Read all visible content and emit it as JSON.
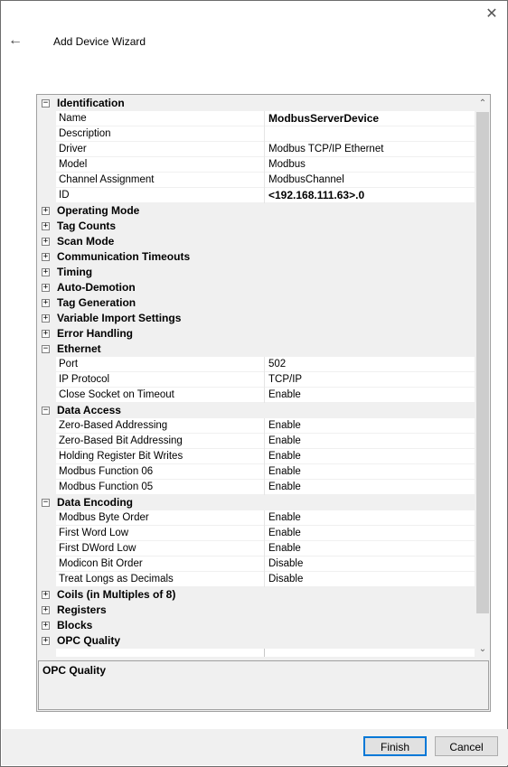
{
  "window": {
    "title": "Add Device Wizard",
    "close_glyph": "✕",
    "back_glyph": "←"
  },
  "grid": {
    "rows": [
      {
        "kind": "cat",
        "label": "Identification",
        "toggle": "−"
      },
      {
        "kind": "prop",
        "name": "Name",
        "value": "ModbusServerDevice",
        "bold": true
      },
      {
        "kind": "prop",
        "name": "Description",
        "value": ""
      },
      {
        "kind": "prop",
        "name": "Driver",
        "value": "Modbus TCP/IP Ethernet"
      },
      {
        "kind": "prop",
        "name": "Model",
        "value": "Modbus"
      },
      {
        "kind": "prop",
        "name": "Channel Assignment",
        "value": "ModbusChannel"
      },
      {
        "kind": "prop",
        "name": "ID",
        "value": "<192.168.111.63>.0",
        "bold": true
      },
      {
        "kind": "cat",
        "label": "Operating Mode",
        "toggle": "+"
      },
      {
        "kind": "cat",
        "label": "Tag Counts",
        "toggle": "+"
      },
      {
        "kind": "cat",
        "label": "Scan Mode",
        "toggle": "+"
      },
      {
        "kind": "cat",
        "label": "Communication Timeouts",
        "toggle": "+"
      },
      {
        "kind": "cat",
        "label": "Timing",
        "toggle": "+"
      },
      {
        "kind": "cat",
        "label": "Auto-Demotion",
        "toggle": "+"
      },
      {
        "kind": "cat",
        "label": "Tag Generation",
        "toggle": "+"
      },
      {
        "kind": "cat",
        "label": "Variable Import Settings",
        "toggle": "+"
      },
      {
        "kind": "cat",
        "label": "Error Handling",
        "toggle": "+"
      },
      {
        "kind": "cat",
        "label": "Ethernet",
        "toggle": "−"
      },
      {
        "kind": "prop",
        "name": "Port",
        "value": "502"
      },
      {
        "kind": "prop",
        "name": "IP Protocol",
        "value": "TCP/IP"
      },
      {
        "kind": "prop",
        "name": "Close Socket on Timeout",
        "value": "Enable"
      },
      {
        "kind": "cat",
        "label": "Data Access",
        "toggle": "−"
      },
      {
        "kind": "prop",
        "name": "Zero-Based Addressing",
        "value": "Enable"
      },
      {
        "kind": "prop",
        "name": "Zero-Based Bit Addressing",
        "value": "Enable"
      },
      {
        "kind": "prop",
        "name": "Holding Register Bit Writes",
        "value": "Enable"
      },
      {
        "kind": "prop",
        "name": "Modbus Function 06",
        "value": "Enable"
      },
      {
        "kind": "prop",
        "name": "Modbus Function 05",
        "value": "Enable"
      },
      {
        "kind": "cat",
        "label": "Data Encoding",
        "toggle": "−"
      },
      {
        "kind": "prop",
        "name": "Modbus Byte Order",
        "value": "Enable"
      },
      {
        "kind": "prop",
        "name": "First Word Low",
        "value": "Enable"
      },
      {
        "kind": "prop",
        "name": "First DWord Low",
        "value": "Enable"
      },
      {
        "kind": "prop",
        "name": "Modicon Bit Order",
        "value": "Disable"
      },
      {
        "kind": "prop",
        "name": "Treat Longs as Decimals",
        "value": "Disable"
      },
      {
        "kind": "cat",
        "label": "Coils (in Multiples of 8)",
        "toggle": "+"
      },
      {
        "kind": "cat",
        "label": "Registers",
        "toggle": "+"
      },
      {
        "kind": "cat",
        "label": "Blocks",
        "toggle": "+"
      },
      {
        "kind": "cat",
        "label": "OPC Quality",
        "toggle": "+"
      },
      {
        "kind": "empty",
        "name": "",
        "value": ""
      }
    ]
  },
  "scroll": {
    "up_glyph": "⌃",
    "down_glyph": "⌄"
  },
  "description": {
    "title": "OPC Quality"
  },
  "buttons": {
    "finish": "Finish",
    "cancel": "Cancel"
  }
}
